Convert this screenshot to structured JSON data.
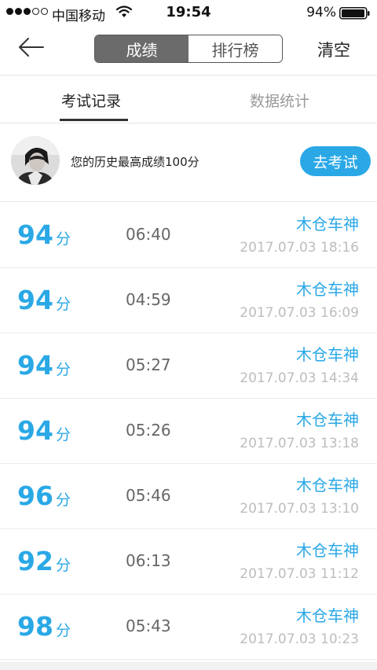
{
  "status_bar": {
    "carrier": "中国移动",
    "time": "19:54",
    "battery": "94%"
  },
  "nav": {
    "segments": [
      "成绩",
      "排行榜"
    ],
    "active_segment": "成绩",
    "clear_label": "清空"
  },
  "tabs": {
    "records_label": "考试记录",
    "stats_label": "数据统计",
    "active_tab": "考试记录"
  },
  "profile": {
    "best_score_text": "您的历史最高成绩100分",
    "take_exam_label": "去考试"
  },
  "score_unit": "分",
  "records": [
    {
      "score": "94",
      "duration": "06:40",
      "name": "木仓车神",
      "date": "2017.07.03 18:16"
    },
    {
      "score": "94",
      "duration": "04:59",
      "name": "木仓车神",
      "date": "2017.07.03 16:09"
    },
    {
      "score": "94",
      "duration": "05:27",
      "name": "木仓车神",
      "date": "2017.07.03 14:34"
    },
    {
      "score": "94",
      "duration": "05:26",
      "name": "木仓车神",
      "date": "2017.07.03 13:18"
    },
    {
      "score": "96",
      "duration": "05:46",
      "name": "木仓车神",
      "date": "2017.07.03 13:10"
    },
    {
      "score": "92",
      "duration": "06:13",
      "name": "木仓车神",
      "date": "2017.07.03 11:12"
    },
    {
      "score": "98",
      "duration": "05:43",
      "name": "木仓车神",
      "date": "2017.07.03 10:23"
    }
  ],
  "colors": {
    "accent": "#2aa8e6",
    "segment_active": "#6b6b6b",
    "date_text": "#bdbdbd"
  },
  "icons": {
    "back": "arrow-left-icon",
    "wifi": "wifi-icon",
    "battery": "battery-icon",
    "signal": "signal-dots-icon"
  }
}
